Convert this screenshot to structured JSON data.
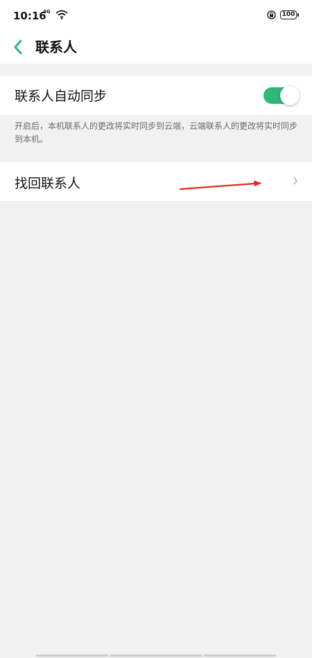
{
  "status_bar": {
    "time": "10:16",
    "network": "4G",
    "battery": "100"
  },
  "header": {
    "title": "联系人",
    "back_icon": "chevron-left-icon",
    "accent_color": "#2fb67c"
  },
  "settings": {
    "auto_sync": {
      "label": "联系人自动同步",
      "enabled": true
    },
    "auto_sync_description": "开启后，本机联系人的更改将实时同步到云端，云端联系人的更改将实时同步到本机。",
    "recover_contacts": {
      "label": "找回联系人",
      "icon": "chevron-right-icon"
    }
  },
  "annotation": {
    "type": "red-arrow",
    "color": "#e02a1f"
  }
}
